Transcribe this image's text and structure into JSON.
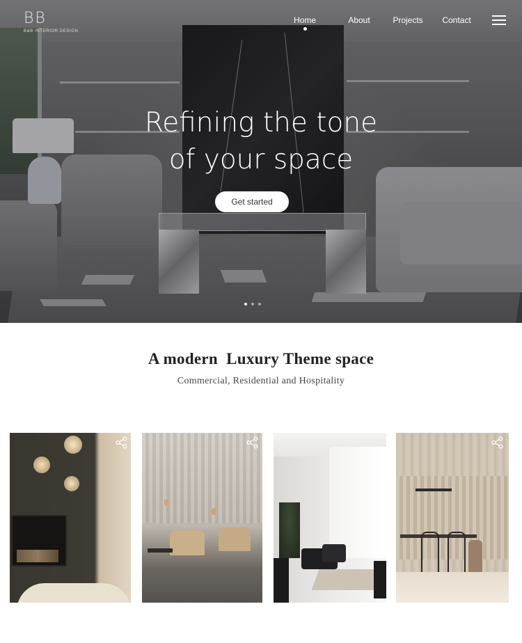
{
  "logo": {
    "mark": "BB",
    "tagline": "B&B INTERIOR DESIGN"
  },
  "nav": {
    "items": [
      {
        "label": "Home",
        "active": true
      },
      {
        "label": "About",
        "active": false
      },
      {
        "label": "Projects",
        "active": false
      },
      {
        "label": "Contact",
        "active": false
      }
    ],
    "menu_icon": "hamburger-menu-icon"
  },
  "hero": {
    "title_line1": "Refining the tone",
    "title_line2": "of your space",
    "cta_label": "Get started",
    "slides_total": 3,
    "slide_active": 1
  },
  "section": {
    "title": "A modern  Luxury Theme space",
    "subtitle": "Commercial, Residential and Hospitality"
  },
  "gallery": {
    "share_icon": "share-icon",
    "items": [
      {
        "theme": "fireplace-lounge"
      },
      {
        "theme": "curtained-lounge"
      },
      {
        "theme": "bright-living-room"
      },
      {
        "theme": "dining-area"
      }
    ]
  },
  "colors": {
    "page_background": "#ffffff",
    "nav_text": "#ffffff",
    "button_background": "#ffffff",
    "heading_text": "#222222"
  }
}
